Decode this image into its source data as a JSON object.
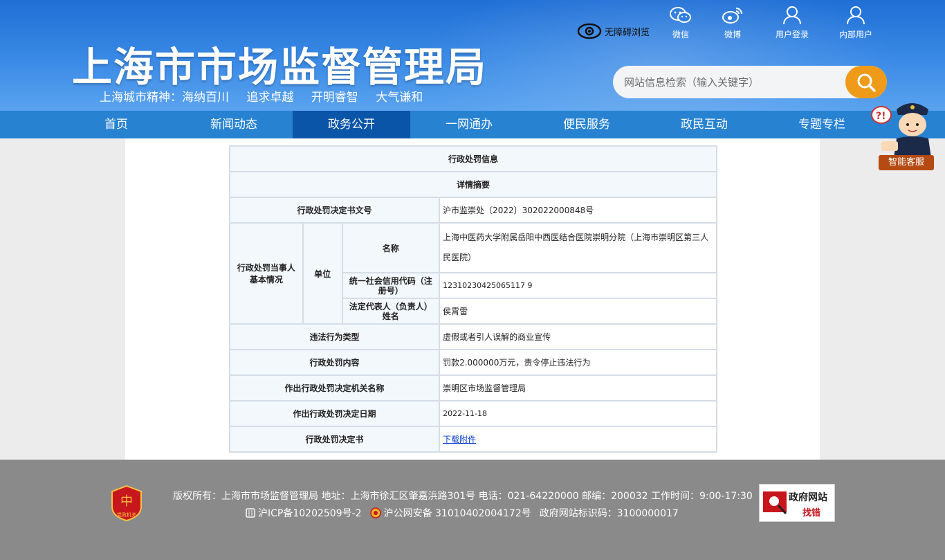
{
  "header": {
    "title": "上海市市场监督管理局",
    "slogan": [
      "上海城市精神：海纳百川",
      "追求卓越",
      "开明睿智",
      "大气谦和"
    ],
    "accessibility_label": "无障碍浏览",
    "tools": [
      {
        "label": "微信",
        "icon": "wechat-icon"
      },
      {
        "label": "微博",
        "icon": "weibo-icon"
      },
      {
        "label": "用户登录",
        "icon": "user-icon"
      },
      {
        "label": "内部用户",
        "icon": "user-icon"
      }
    ],
    "search_placeholder": "网站信息检索（输入关键字）"
  },
  "nav": {
    "items": [
      "首页",
      "新闻动态",
      "政务公开",
      "一网通办",
      "便民服务",
      "政民互动",
      "专题专栏"
    ],
    "active": "政务公开"
  },
  "helper": {
    "label": "智能客服"
  },
  "detail": {
    "title": "行政处罚信息",
    "subtitle": "详情摘要",
    "doc_no_label": "行政处罚决定书文号",
    "doc_no": "沪市监崇处〔2022〕302022000848号",
    "party_label": "行政处罚当事人基本情况",
    "unit_label": "单位",
    "name_label": "名称",
    "name": "上海中医药大学附属岳阳中西医结合医院崇明分院（上海市崇明区第三人民医院）",
    "credit_code_label": "统一社会信用代码（注册号）",
    "credit_code": "12310230425065117 9",
    "legal_rep_label": "法定代表人（负责人）姓名",
    "legal_rep": "侯霄雷",
    "violation_label": "违法行为类型",
    "violation": "虚假或者引人误解的商业宣传",
    "penalty_label": "行政处罚内容",
    "penalty": "罚款2.000000万元，责令停止违法行为",
    "authority_label": "作出行政处罚决定机关名称",
    "authority": "崇明区市场监督管理局",
    "date_label": "作出行政处罚决定日期",
    "date": "2022-11-18",
    "decision_label": "行政处罚决定书",
    "decision_link": "下载附件"
  },
  "footer": {
    "line1": "版权所有：上海市市场监督管理局 地址：上海市徐汇区肇嘉浜路301号 电话：021-64220000 邮编：200032 工作时间：9:00-17:30",
    "icp": "沪ICP备10202509号-2",
    "police": "沪公网安备 31010402004172号",
    "site_id": "政府网站标识码：3100000017",
    "party_badge": "党政机关",
    "find_error_title": "政府网站",
    "find_error_action": "找错"
  }
}
